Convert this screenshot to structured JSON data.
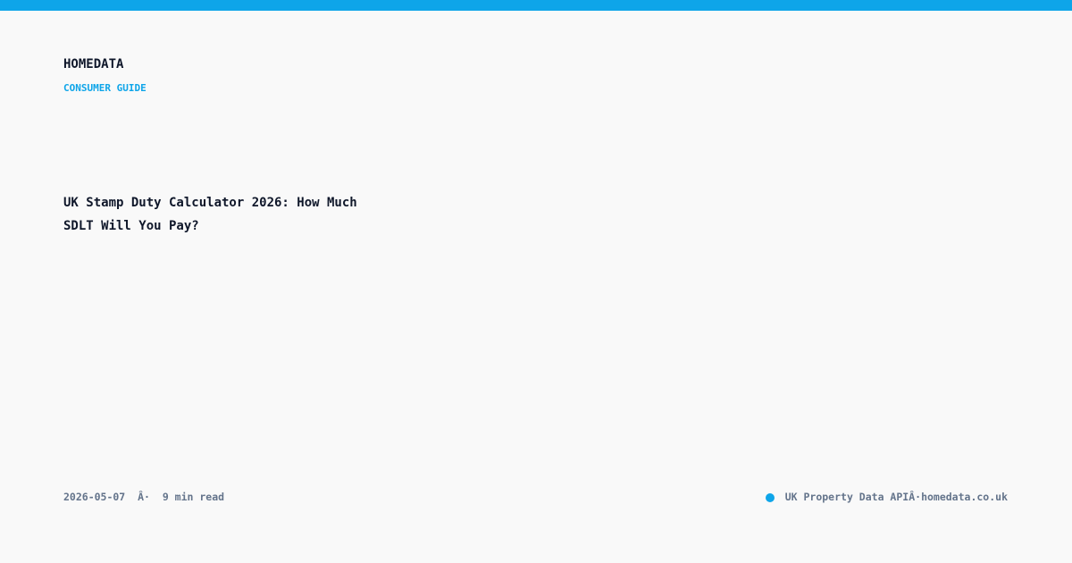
{
  "colors": {
    "accent": "#0ea5e9",
    "background": "#f9f9f9",
    "title": "#0f172a",
    "muted": "#64748b"
  },
  "brand": "HOMEDATA",
  "category": "CONSUMER GUIDE",
  "headline": "UK Stamp Duty Calculator 2026: How Much SDLT Will You Pay?",
  "meta": {
    "date": "2026-05-07",
    "separator": "Â·",
    "read_time": "9 min read"
  },
  "footer": {
    "indicator_icon": "dot-icon",
    "product": "UK Property Data API",
    "separator": "Â·",
    "site": "homedata.co.uk"
  }
}
